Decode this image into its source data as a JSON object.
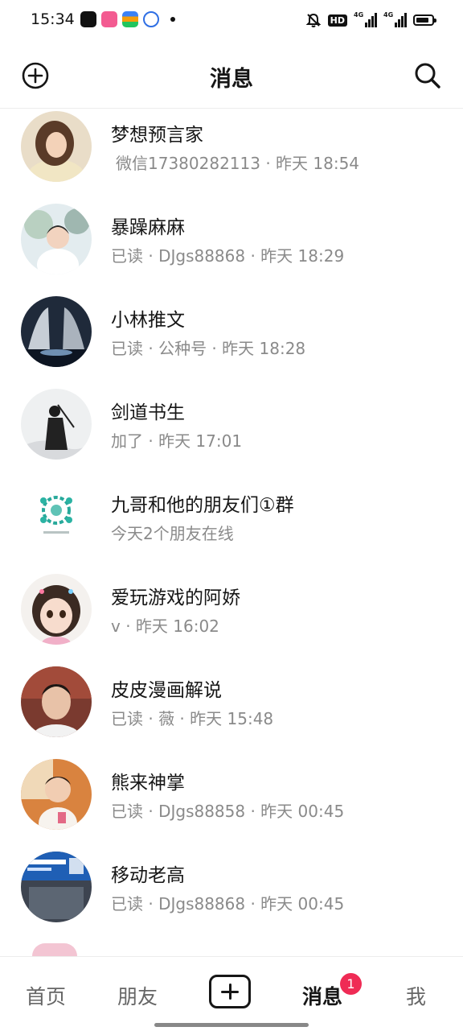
{
  "status_bar": {
    "time": "15:34",
    "network_1": "4G",
    "network_2": "4G",
    "hd_label": "HD"
  },
  "header": {
    "title": "消息"
  },
  "conversations": [
    {
      "name": "梦想预言家",
      "subtitle": "微信17380282113 · 昨天 18:54"
    },
    {
      "name": "暴躁麻麻",
      "subtitle": "已读 · DJgs88868 · 昨天 18:29"
    },
    {
      "name": "小林推文",
      "subtitle": "已读 · 公种号 · 昨天 18:28"
    },
    {
      "name": "剑道书生",
      "subtitle": "加了 · 昨天 17:01"
    },
    {
      "name": "九哥和他的朋友们①群",
      "subtitle": "今天2个朋友在线"
    },
    {
      "name": "爱玩游戏的阿娇",
      "subtitle": "v · 昨天 16:02"
    },
    {
      "name": "皮皮漫画解说",
      "subtitle": "已读 · 薇 · 昨天 15:48"
    },
    {
      "name": "熊来神掌",
      "subtitle": "已读 · DJgs88858 · 昨天 00:45"
    },
    {
      "name": "移动老高",
      "subtitle": "已读 · DJgs88868 · 昨天 00:45"
    }
  ],
  "bottom_nav": {
    "home": "首页",
    "friends": "朋友",
    "messages": "消息",
    "me": "我",
    "messages_badge": "1"
  },
  "icons": {
    "header_left": "add-circle-icon",
    "header_right": "search-icon",
    "center_tab": "plus-box-icon"
  },
  "colors": {
    "badge": "#ef2b55",
    "text_primary": "#161616",
    "text_secondary": "#8a8a8a"
  }
}
